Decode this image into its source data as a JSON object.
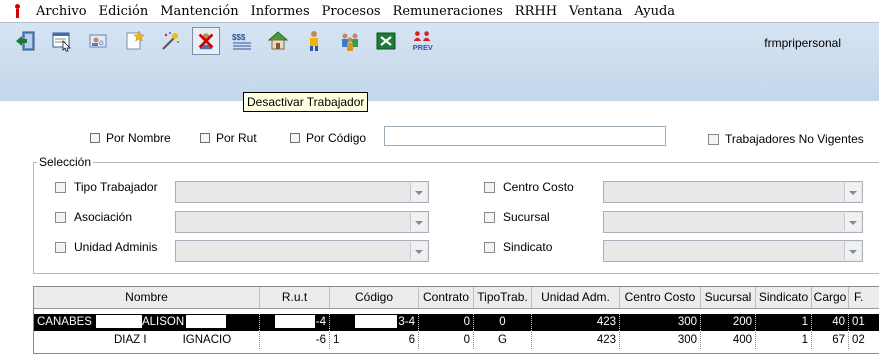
{
  "menu": {
    "items": [
      "Archivo",
      "Edición",
      "Mantención",
      "Informes",
      "Procesos",
      "Remuneraciones",
      "RRHH",
      "Ventana",
      "Ayuda"
    ]
  },
  "toolbar": {
    "icons": [
      "exit-door-icon",
      "window-list-icon",
      "employee-card-icon",
      "new-star-icon",
      "wizard-icon",
      "deactivate-worker-icon",
      "salary-money-icon",
      "house-icon",
      "person-icon",
      "group-people-icon",
      "excel-icon",
      "previred-icon"
    ],
    "prev_label": "PREV",
    "tooltip": "Desactivar Trabajador"
  },
  "window_title": "frmpripersonal",
  "filters": {
    "por_nombre": "Por Nombre",
    "por_rut": "Por Rut",
    "por_codigo": "Por Código",
    "search_value": "",
    "no_vigentes": "Trabajadores No Vigentes"
  },
  "seleccion": {
    "title": "Selección",
    "left": [
      "Tipo Trabajador",
      "Asociación",
      "Unidad Adminis"
    ],
    "right": [
      "Centro Costo",
      "Sucursal",
      "Sindicato"
    ]
  },
  "grid": {
    "columns": [
      "Nombre",
      "R.u.t",
      "Código",
      "Contrato",
      "TipoTrab.",
      "Unidad Adm.",
      "Centro Costo",
      "Sucursal",
      "Sindicato",
      "Cargo",
      "F."
    ],
    "rows": [
      {
        "nombre_a": "CANABES",
        "nombre_b": "ALISON",
        "rut": "-4",
        "codigo": "3-4",
        "contrato": "0",
        "tipo": "0",
        "unidad": "423",
        "centro": "300",
        "sucursal": "200",
        "sindicato": "1",
        "cargo": "40",
        "f": "01"
      },
      {
        "nombre_a": "DIAZ I",
        "nombre_b": "IGNACIO",
        "rut": "-6",
        "codigo_a": "1",
        "codigo": "6",
        "contrato": "0",
        "tipo": "G",
        "unidad": "423",
        "centro": "300",
        "sucursal": "400",
        "sindicato": "1",
        "cargo": "67",
        "f": "02"
      }
    ]
  },
  "colors": {
    "toolbar_bg": "#c9daec",
    "selected_row": "#000000",
    "tooltip_bg": "#ffffe1"
  }
}
